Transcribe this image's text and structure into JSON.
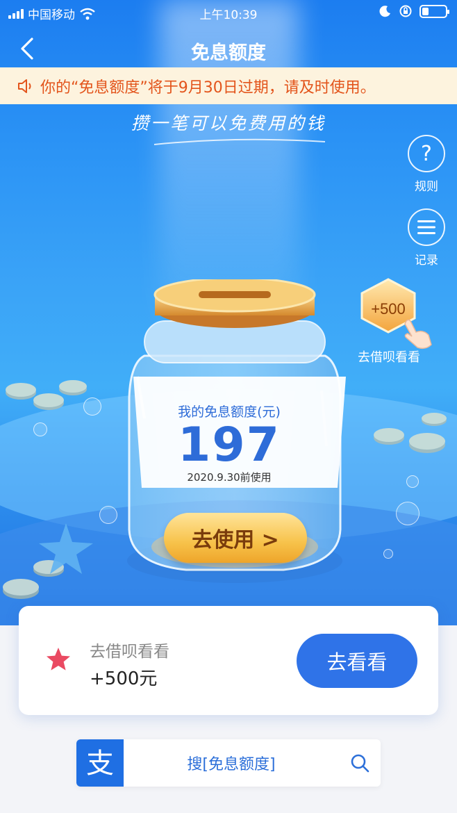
{
  "status_bar": {
    "carrier": "中国移动",
    "time": "上午10:39"
  },
  "nav": {
    "title": "免息额度"
  },
  "notice": {
    "text": "你的“免息额度”将于9月30日过期，请及时使用。"
  },
  "slogan": "攒一笔可以免费用的钱",
  "side": {
    "rules_label": "规则",
    "records_label": "记录",
    "rules_icon_glyph": "?"
  },
  "promo": {
    "badge": "+500",
    "label": "去借呗看看"
  },
  "jar": {
    "title": "我的免息额度(元)",
    "value": "197",
    "date": "2020.9.30前使用"
  },
  "use_button": "去使用 >",
  "card": {
    "subtitle": "去借呗看看",
    "amount": "+500元",
    "button": "去看看"
  },
  "search": {
    "logo_glyph": "支",
    "text": "搜[免息额度]"
  },
  "colors": {
    "primary_blue": "#2f73e8",
    "notice_text": "#e3541b",
    "notice_bg": "#fdf3de",
    "gold": "#f7c24a"
  }
}
